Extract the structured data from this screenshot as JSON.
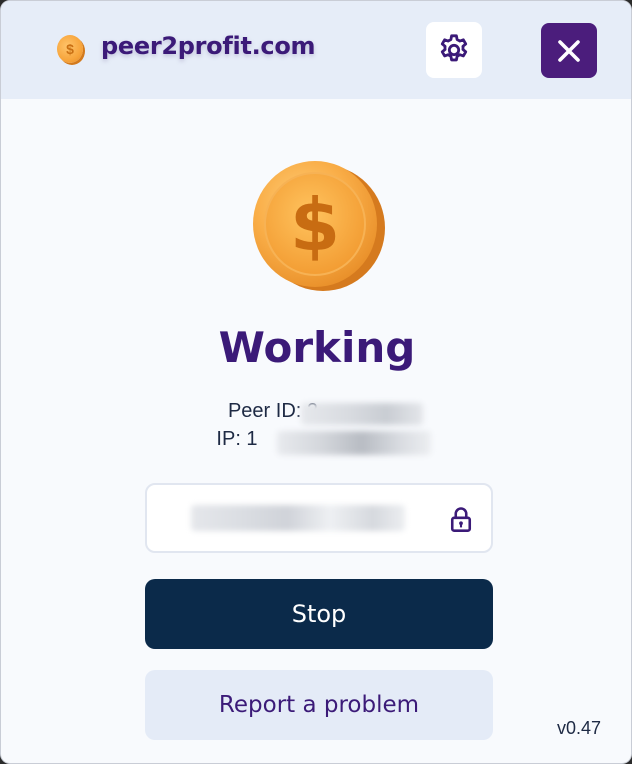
{
  "header": {
    "brand": "peer2profit.com",
    "logo_icon": "coin-icon",
    "settings_icon": "gear-icon",
    "close_icon": "close-icon",
    "close_button_color": "#4b1d7c"
  },
  "main": {
    "status_icon": "dollar-coin-icon",
    "status": "Working",
    "peer_id": "Peer ID: 2",
    "ip": "IP: 1",
    "field_icon": "lock-icon",
    "stop_label": "Stop",
    "report_label": "Report a problem"
  },
  "footer": {
    "version": "v0.47"
  },
  "colors": {
    "brand_purple": "#3b1a78",
    "stop_navy": "#0b2a4a",
    "coin_orange": "#f7a53c"
  }
}
